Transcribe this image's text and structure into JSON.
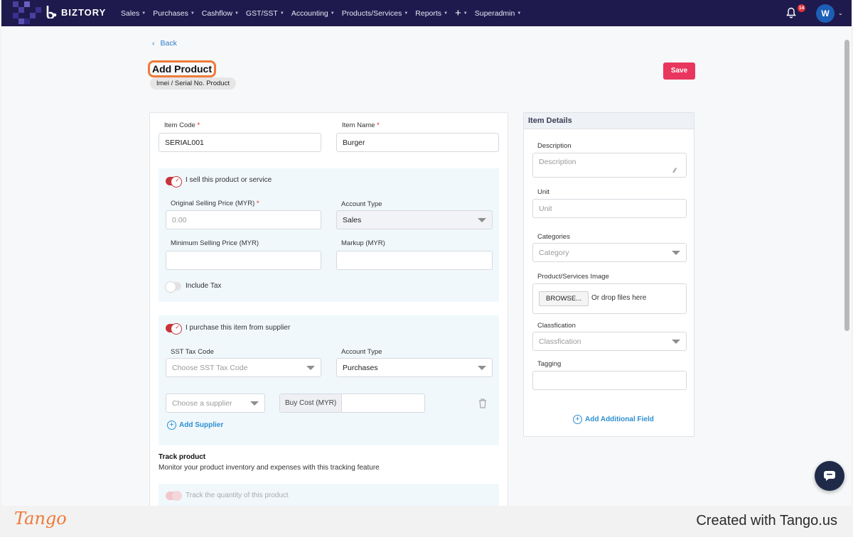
{
  "nav": {
    "brand": "BIZTORY",
    "menu": [
      {
        "label": "Sales"
      },
      {
        "label": "Purchases"
      },
      {
        "label": "Cashflow"
      },
      {
        "label": "GST/SST"
      },
      {
        "label": "Accounting"
      },
      {
        "label": "Products/Services"
      },
      {
        "label": "Reports"
      },
      {
        "label": "+"
      },
      {
        "label": "Superadmin"
      }
    ],
    "notification_count": "14",
    "avatar_initial": "W"
  },
  "header": {
    "back_label": "Back",
    "title": "Add Product",
    "subtitle": "Imei / Serial No. Product",
    "save_label": "Save"
  },
  "form": {
    "item_code_label": "Item Code",
    "item_code_value": "SERIAL001",
    "item_name_label": "Item Name",
    "item_name_value": "Burger",
    "required_mark": "*",
    "sell": {
      "toggle_label": "I sell this product or service",
      "toggle_on": true,
      "price_label": "Original Selling Price (MYR)",
      "price_placeholder": "0.00",
      "account_type_label": "Account Type",
      "account_type_value": "Sales",
      "min_price_label": "Minimum Selling Price (MYR)",
      "markup_label": "Markup (MYR)",
      "include_tax_label": "Include Tax",
      "include_tax_on": false
    },
    "purchase": {
      "toggle_label": "I purchase this item from supplier",
      "toggle_on": true,
      "sst_label": "SST Tax Code",
      "sst_placeholder": "Choose SST Tax Code",
      "account_type_label": "Account Type",
      "account_type_value": "Purchases",
      "supplier_placeholder": "Choose a supplier",
      "buy_cost_label": "Buy Cost (MYR)",
      "add_supplier_label": "Add Supplier"
    },
    "track": {
      "title": "Track product",
      "description": "Monitor your product inventory and expenses with this tracking feature",
      "quantity_label": "Track the quantity of this product"
    }
  },
  "details": {
    "heading": "Item Details",
    "description_label": "Description",
    "description_placeholder": "Description",
    "unit_label": "Unit",
    "unit_placeholder": "Unit",
    "categories_label": "Categories",
    "categories_placeholder": "Category",
    "image_label": "Product/Services Image",
    "browse_label": "BROWSE...",
    "drop_text": "Or drop files here",
    "classification_label": "Classfication",
    "classification_placeholder": "Classfication",
    "tagging_label": "Tagging",
    "add_field_label": "Add Additional Field"
  },
  "footer": {
    "tango_logo": "Tango",
    "created_with": "Created with Tango.us"
  },
  "colors": {
    "nav_bg": "#1f1a4d",
    "accent_save": "#e8365f",
    "toggle_on": "#c8343a",
    "link_blue": "#2d8fd0",
    "panel_bg": "#f0f8fc",
    "highlight_orange": "#ef7a3a"
  }
}
